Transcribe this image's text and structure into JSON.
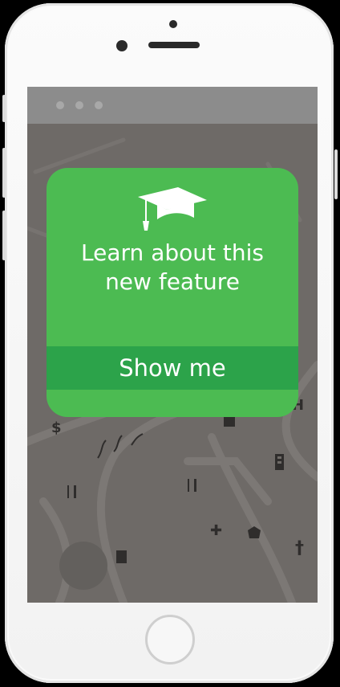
{
  "popup": {
    "title": "Learn about this\nnew feature",
    "button_label": "Show me",
    "icon": "graduation-cap-icon",
    "color": "#4cbb52",
    "button_color": "#2ca34a"
  },
  "map": {
    "icons": {
      "dollar": "$",
      "cross": "✚",
      "dagger": "†",
      "h": "H"
    }
  },
  "colors": {
    "map_background": "#6e6a67",
    "browser_bar": "#8c8c8c",
    "phone_body": "#f7f7f7"
  }
}
